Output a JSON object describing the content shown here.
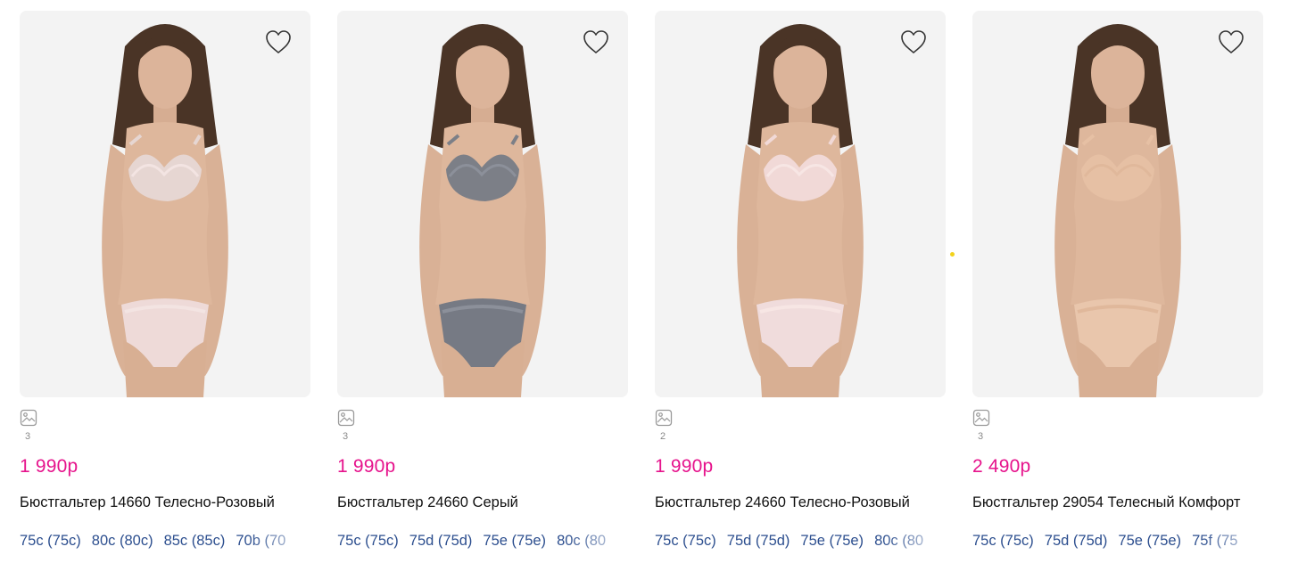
{
  "accent_color": "#e6138c",
  "size_color": "#2d4f8f",
  "products": [
    {
      "photo_count": "3",
      "price": "1 990р",
      "name": "Бюстгальтер 14660 Телесно-Розовый",
      "sizes": [
        "75c (75c)",
        "80c (80c)",
        "85c (85c)",
        "70b (70"
      ],
      "colors": {
        "top": "#e6d6d2",
        "bottom": "#eedad8",
        "lace": "#f3e4e2"
      }
    },
    {
      "photo_count": "3",
      "price": "1 990р",
      "name": "Бюстгальтер 24660 Серый",
      "sizes": [
        "75c (75c)",
        "75d (75d)",
        "75e (75e)",
        "80c (80"
      ],
      "colors": {
        "top": "#7c7f87",
        "bottom": "#767a84",
        "lace": "#8c909a"
      }
    },
    {
      "photo_count": "2",
      "price": "1 990р",
      "name": "Бюстгальтер 24660 Телесно-Розовый",
      "sizes": [
        "75c (75c)",
        "75d (75d)",
        "75e (75e)",
        "80c (80"
      ],
      "colors": {
        "top": "#f1d9d7",
        "bottom": "#f0dcdc",
        "lace": "#f7e6e4"
      }
    },
    {
      "photo_count": "3",
      "price": "2 490р",
      "name": "Бюстгальтер 29054 Телесный Комфорт",
      "sizes": [
        "75c (75c)",
        "75d (75d)",
        "75e (75e)",
        "75f (75"
      ],
      "colors": {
        "top": "#e6c0a4",
        "bottom": "#e9c6ac",
        "lace": "#e0b89b"
      }
    }
  ]
}
